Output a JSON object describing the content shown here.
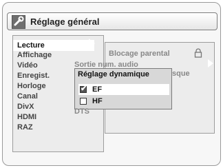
{
  "header": {
    "title": "Réglage général"
  },
  "menu": [
    {
      "label": "Lecture",
      "selected": true
    },
    {
      "label": "Affichage"
    },
    {
      "label": "Vidéo"
    },
    {
      "label": "Enregist."
    },
    {
      "label": "Horloge"
    },
    {
      "label": "Canal"
    },
    {
      "label": "DivX"
    },
    {
      "label": "HDMI"
    },
    {
      "label": "RAZ"
    }
  ],
  "submenu": {
    "items": [
      {
        "label": "Blocage parental"
      },
      {
        "label": "Sortie num. audio"
      },
      {
        "label": "sque"
      },
      {
        "label": "DTS"
      }
    ]
  },
  "popup": {
    "title": "Réglage dynamique",
    "options": [
      {
        "label": "EF",
        "checked": true,
        "selected": true
      },
      {
        "label": "HF",
        "checked": false,
        "selected": false
      }
    ]
  },
  "colors": {
    "selection": "#ffffff",
    "panel": "#ececec",
    "popup": "#d8d8d8"
  }
}
